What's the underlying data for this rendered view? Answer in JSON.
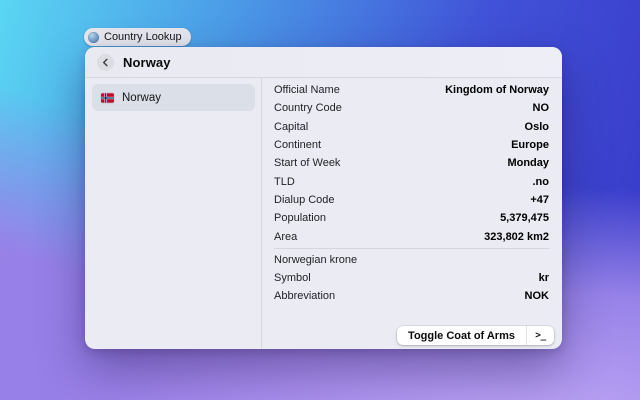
{
  "colors": {
    "bg_top_left": "#5ad6f3",
    "bg_top_right": "#3a3dcb",
    "bg_bottom": "#ab8fee",
    "window_bg": "#ebebf3",
    "selected_item_bg": "#dbdfe7",
    "flag_red": "#ba0c2f",
    "flag_blue": "#00205b"
  },
  "tag": {
    "label": "Country Lookup",
    "icon": "globe-icon"
  },
  "window": {
    "title": "Norway",
    "back_icon": "chevron-left",
    "sidebar": {
      "items": [
        {
          "label": "Norway",
          "icon": "norway-flag-icon",
          "selected": true
        }
      ]
    },
    "details": {
      "rows": [
        {
          "label": "Official Name",
          "value": "Kingdom of Norway"
        },
        {
          "label": "Country Code",
          "value": "NO"
        },
        {
          "label": "Capital",
          "value": "Oslo"
        },
        {
          "label": "Continent",
          "value": "Europe"
        },
        {
          "label": "Start of Week",
          "value": "Monday"
        },
        {
          "label": "TLD",
          "value": ".no"
        },
        {
          "label": "Dialup Code",
          "value": "+47"
        },
        {
          "label": "Population",
          "value": "5,379,475"
        },
        {
          "label": "Area",
          "value": "323,802 km2"
        }
      ],
      "currency": {
        "name": "Norwegian krone",
        "rows": [
          {
            "label": "Symbol",
            "value": "kr"
          },
          {
            "label": "Abbreviation",
            "value": "NOK"
          }
        ]
      }
    },
    "footer": {
      "toggle_label": "Toggle Coat of Arms",
      "terminal_glyph": ">_"
    }
  }
}
